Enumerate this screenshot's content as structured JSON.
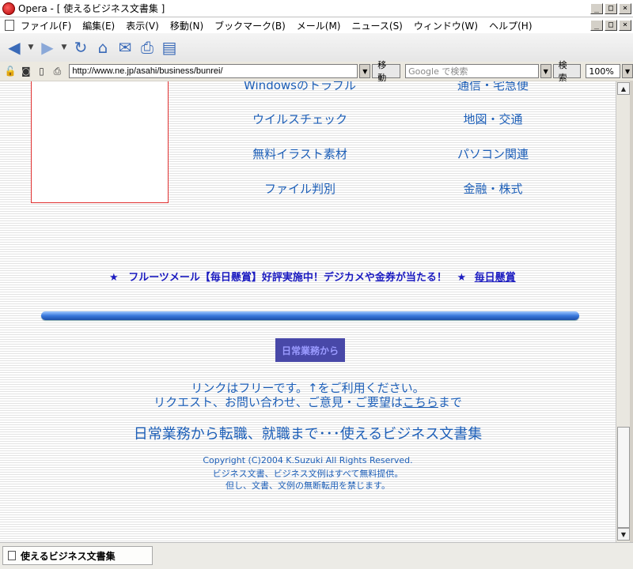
{
  "window": {
    "title": "Opera - [ 使えるビジネス文書集 ]",
    "min": "_",
    "max": "□",
    "close": "×"
  },
  "menu": [
    "ファイル(F)",
    "編集(E)",
    "表示(V)",
    "移動(N)",
    "ブックマーク(B)",
    "メール(M)",
    "ニュース(S)",
    "ウィンドウ(W)",
    "ヘルプ(H)"
  ],
  "address": {
    "url": "http://www.ne.jp/asahi/business/bunrei/",
    "go_label": "移動",
    "search_placeholder": "Google で検索",
    "search_label": "検索",
    "zoom": "100%"
  },
  "links": {
    "col1": [
      "Windowsのトラブル",
      "ウイルスチェック",
      "無料イラスト素材",
      "ファイル判別"
    ],
    "col2": [
      "通信・宅急便",
      "地図・交通",
      "パソコン関連",
      "金融・株式"
    ]
  },
  "promo": {
    "star1": "★",
    "text": "フルーツメール【毎日懸賞】好評実施中！デジカメや金券が当たる！",
    "star2": "★",
    "link": "毎日懸賞"
  },
  "footer": {
    "logo_text": "日常業務から",
    "line1": "リンクはフリーです。↑をご利用ください。",
    "line2_prefix": "リクエスト、お問い合わせ、ご意見・ご要望は",
    "line2_link": "こちら",
    "line2_suffix": "まで",
    "tagline": "日常業務から転職、就職まで･･･使えるビジネス文書集",
    "copyright1": "Copyright (C)2004 K.Suzuki All Rights Reserved.",
    "copyright2": "ビジネス文書、ビジネス文例はすべて無料提供。",
    "copyright3": "但し、文書、文例の無断転用を禁じます。"
  },
  "status": {
    "tab_title": "使えるビジネス文書集"
  },
  "colors": {
    "link": "#1d5fb8",
    "promo": "#1a1ac0"
  }
}
